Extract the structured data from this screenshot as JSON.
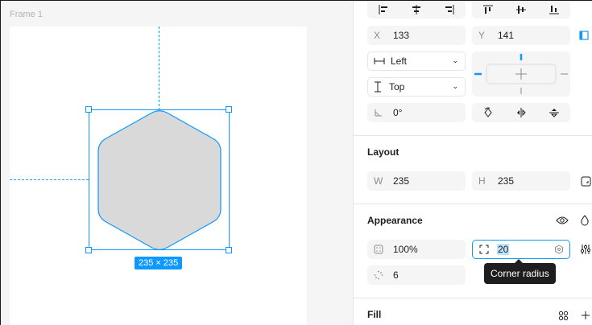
{
  "canvas": {
    "frame_label": "Frame 1",
    "size_badge": "235 × 235",
    "shape": {
      "sides": 6,
      "corner_radius": 20,
      "fill": "#d9d9d9",
      "stroke": "#0d99ff"
    }
  },
  "position": {
    "x_label": "X",
    "x_value": "133",
    "y_label": "Y",
    "y_value": "141",
    "h_constraint": "Left",
    "v_constraint": "Top",
    "rotation": "0°"
  },
  "layout": {
    "title": "Layout",
    "w_label": "W",
    "w_value": "235",
    "h_label": "H",
    "h_value": "235"
  },
  "appearance": {
    "title": "Appearance",
    "opacity": "100%",
    "corner_radius": "20",
    "count": "6",
    "tooltip": "Corner radius"
  },
  "fill": {
    "title": "Fill"
  },
  "colors": {
    "accent": "#0d99ff",
    "field_bg": "#f5f5f5",
    "border": "#e6e6e6"
  }
}
